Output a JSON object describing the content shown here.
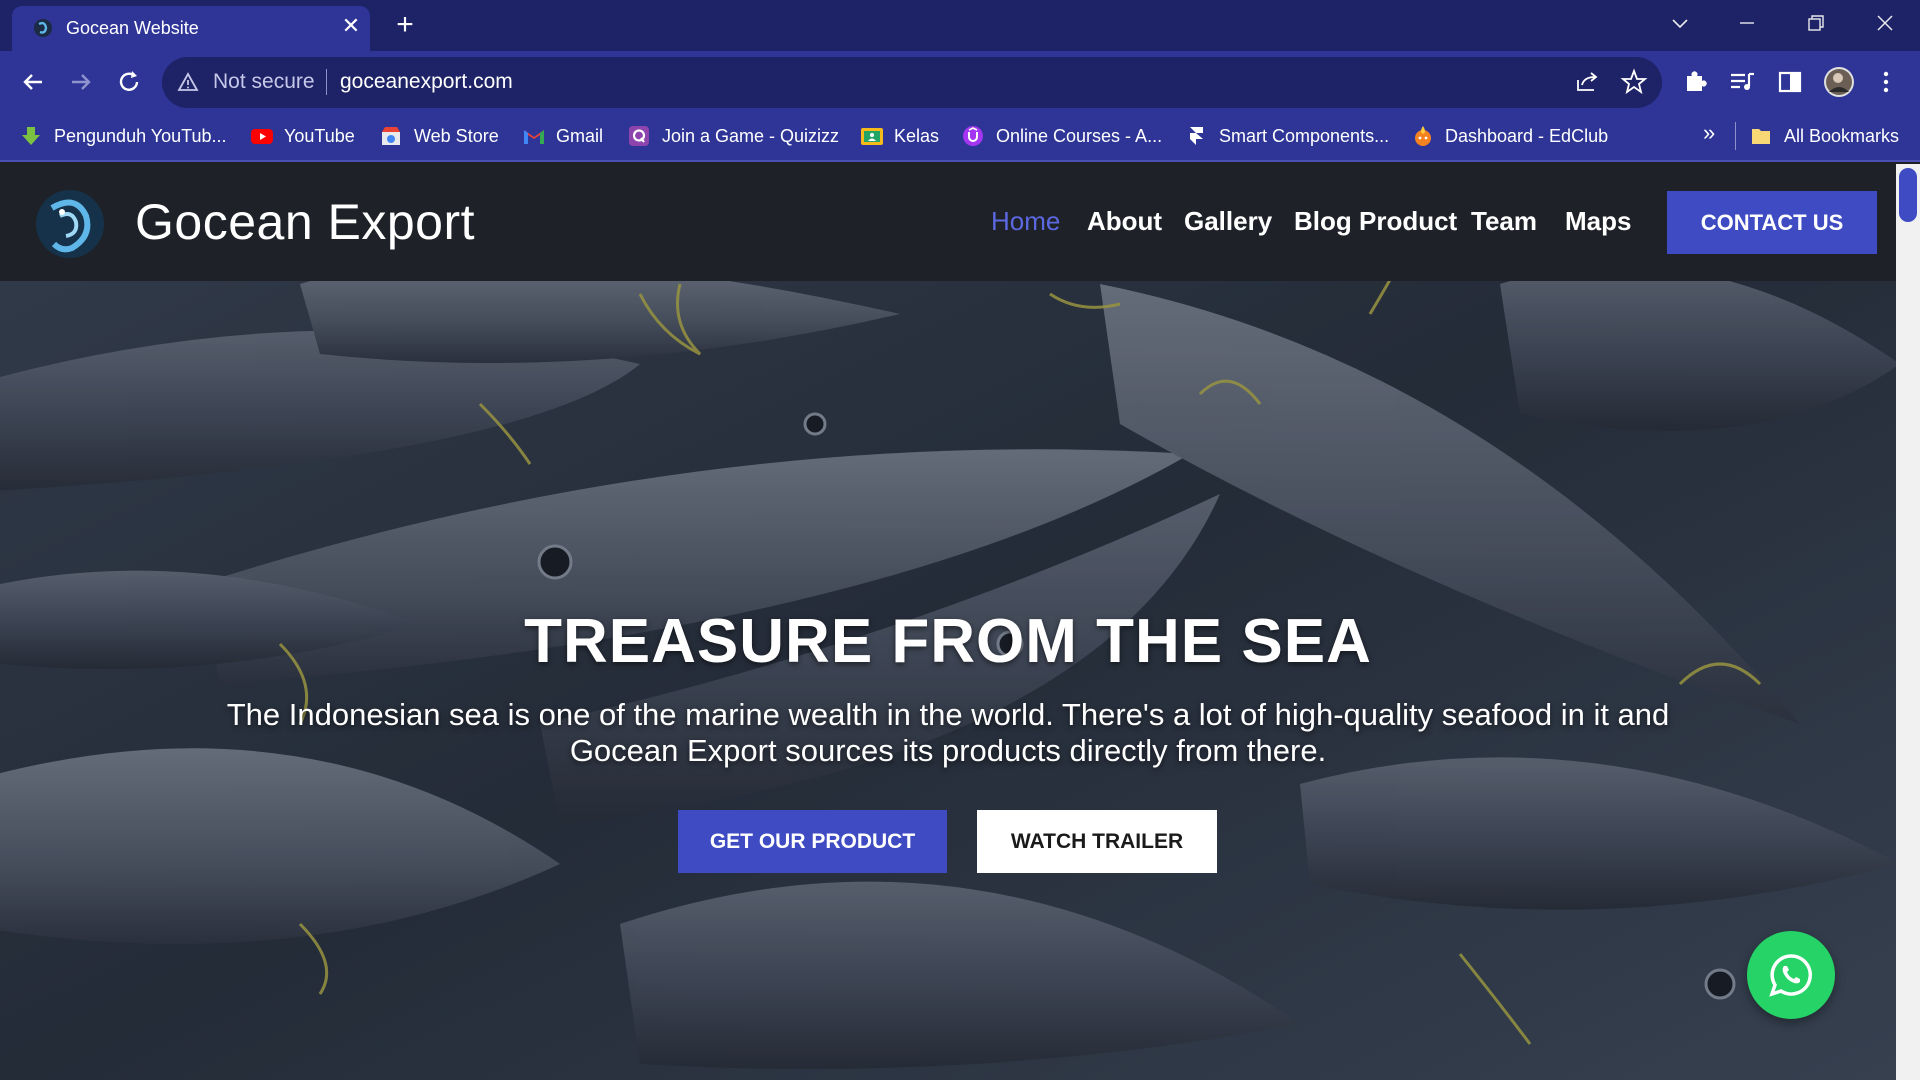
{
  "browser": {
    "tab_title": "Gocean Website",
    "tab_close": "✕",
    "new_tab": "+",
    "security_label": "Not secure",
    "url": "goceanexport.com",
    "bookmarks": [
      {
        "label": "Pengunduh YouTub...",
        "icon": "download-arrow-icon",
        "color": "#7cc242"
      },
      {
        "label": "YouTube",
        "icon": "youtube-icon",
        "color": "#ff0000"
      },
      {
        "label": "Web Store",
        "icon": "web-store-icon",
        "color": "#4285f4"
      },
      {
        "label": "Gmail",
        "icon": "gmail-icon",
        "color": "#ea4335"
      },
      {
        "label": "Join a Game - Quizizz",
        "icon": "quizizz-icon",
        "color": "#8e44ad"
      },
      {
        "label": "Kelas",
        "icon": "classroom-icon",
        "color": "#f6bb18"
      },
      {
        "label": "Online Courses - A...",
        "icon": "online-courses-icon",
        "color": "#a435f0"
      },
      {
        "label": "Smart Components...",
        "icon": "framer-icon",
        "color": "#ffffff"
      },
      {
        "label": "Dashboard - EdClub",
        "icon": "edclub-icon",
        "color": "#f58220"
      }
    ],
    "bookmarks_more": "»",
    "all_bookmarks": "All Bookmarks"
  },
  "site": {
    "brand": "Gocean Export",
    "nav": [
      {
        "label": "Home",
        "active": true
      },
      {
        "label": "About",
        "active": false
      },
      {
        "label": "Gallery",
        "active": false
      },
      {
        "label": "Blog Product",
        "active": false
      },
      {
        "label": "Team",
        "active": false
      },
      {
        "label": "Maps",
        "active": false
      }
    ],
    "contact_label": "CONTACT US"
  },
  "hero": {
    "title": "TREASURE FROM THE SEA",
    "subtitle_line1": "The Indonesian sea is one of the marine wealth in the world. There's a lot of high-quality seafood in it and",
    "subtitle_line2": "Gocean Export sources its products directly from there.",
    "primary_cta": "GET OUR PRODUCT",
    "secondary_cta": "WATCH TRAILER"
  },
  "colors": {
    "browser_frame": "#1e2266",
    "browser_toolbar": "#2e3596",
    "accent": "#3f4bc2",
    "nav_active": "#5b68e0",
    "header_bg": "#1e2228",
    "whatsapp": "#25d366"
  }
}
